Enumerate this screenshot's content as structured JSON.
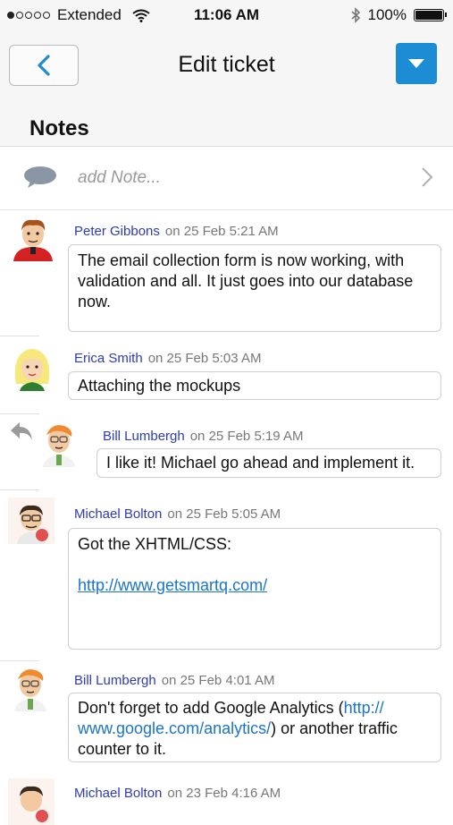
{
  "status_bar": {
    "carrier": "Extended",
    "time": "11:06 AM",
    "battery": "100%"
  },
  "nav": {
    "title": "Edit ticket",
    "back_icon": "chevron-left-icon",
    "menu_icon": "caret-down-icon",
    "accent_color": "#1c8dd4"
  },
  "section": {
    "title": "Notes"
  },
  "add_note": {
    "placeholder": "add Note..."
  },
  "notes": [
    {
      "author": "Peter Gibbons",
      "timestamp": "on 25 Feb 5:21 AM",
      "text": "The email collection form is now working, with validation and all. It just goes into our database now."
    },
    {
      "author": "Erica Smith",
      "timestamp": "on 25 Feb 5:03 AM",
      "text": "Attaching the mockups"
    },
    {
      "author": "Bill Lumbergh",
      "timestamp": "on 25 Feb 5:19 AM",
      "text": "I like it! Michael go ahead and implement it.",
      "is_reply": true
    },
    {
      "author": "Michael Bolton",
      "timestamp": "on 25 Feb 5:05 AM",
      "text": "Got the XHTML/CSS:",
      "link": "http://www.getsmartq.com/"
    },
    {
      "author": "Bill Lumbergh",
      "timestamp": "on 25 Feb 4:01 AM",
      "text_before": "Don't forget to add Google Analytics (",
      "link_line1": "http://",
      "link_line2": "www.google.com/analytics/",
      "text_after": ") or another traffic counter to it."
    },
    {
      "author": "Michael Bolton",
      "timestamp": "on 23 Feb 4:16 AM"
    }
  ]
}
